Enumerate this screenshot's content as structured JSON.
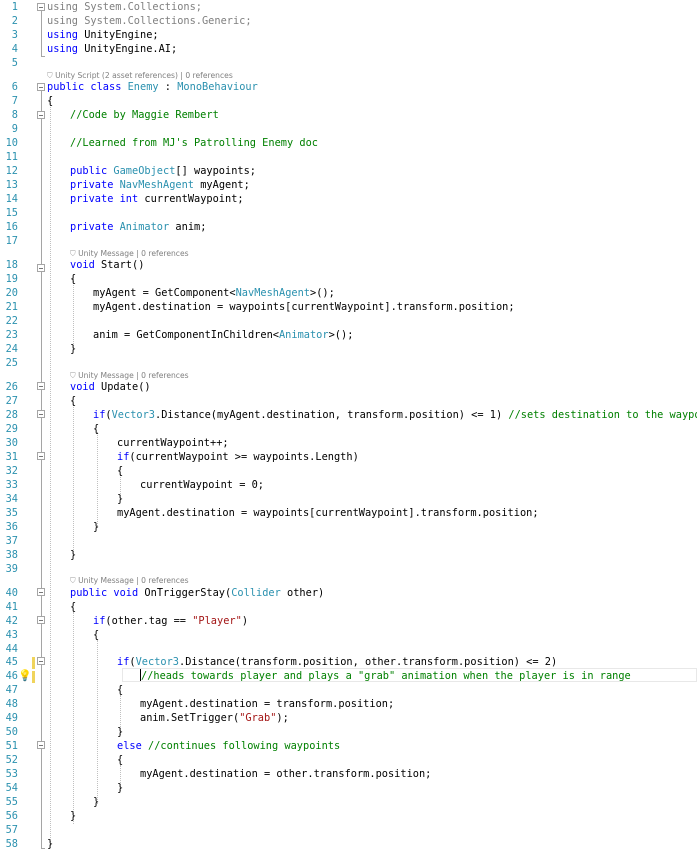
{
  "editor": {
    "codelens": {
      "class": "Unity Script (2 asset references) | 0 references",
      "start": "Unity Message | 0 references",
      "update": "Unity Message | 0 references",
      "trigger": "Unity Message | 0 references"
    },
    "line_numbers": [
      "1",
      "2",
      "3",
      "4",
      "5",
      "6",
      "7",
      "8",
      "9",
      "10",
      "11",
      "12",
      "13",
      "14",
      "15",
      "16",
      "17",
      "18",
      "19",
      "20",
      "21",
      "22",
      "23",
      "24",
      "25",
      "26",
      "27",
      "28",
      "29",
      "30",
      "31",
      "32",
      "33",
      "34",
      "35",
      "36",
      "37",
      "38",
      "39",
      "40",
      "41",
      "42",
      "43",
      "44",
      "45",
      "46",
      "47",
      "48",
      "49",
      "50",
      "51",
      "52",
      "53",
      "54",
      "55",
      "56",
      "57",
      "58"
    ],
    "colors": {
      "keyword": "#0000ff",
      "type": "#2b91af",
      "comment": "#008000",
      "string": "#a31515",
      "line_number": "#2b91af"
    },
    "code": {
      "l1a": "using",
      "l1b": " System.Collections;",
      "l2a": "using",
      "l2b": " System.Collections.Generic;",
      "l3a": "using",
      "l3b": " UnityEngine;",
      "l4a": "using",
      "l4b": " UnityEngine.AI;",
      "l6a": "public",
      "l6b": " ",
      "l6c": "class",
      "l6d": " ",
      "l6e": "Enemy",
      "l6f": " : ",
      "l6g": "MonoBehaviour",
      "l7": "{",
      "l8": "//Code by Maggie Rembert",
      "l10": "//Learned from MJ's Patrolling Enemy doc",
      "l12a": "public",
      "l12b": " ",
      "l12c": "GameObject",
      "l12d": "[] waypoints;",
      "l13a": "private",
      "l13b": " ",
      "l13c": "NavMeshAgent",
      "l13d": " myAgent;",
      "l14a": "private",
      "l14b": " ",
      "l14c": "int",
      "l14d": " currentWaypoint;",
      "l16a": "private",
      "l16b": " ",
      "l16c": "Animator",
      "l16d": " anim;",
      "l18a": "void",
      "l18b": " Start()",
      "l19": "{",
      "l20a": "myAgent = GetComponent<",
      "l20b": "NavMeshAgent",
      "l20c": ">();",
      "l21": "myAgent.destination = waypoints[currentWaypoint].transform.position;",
      "l23a": "anim = GetComponentInChildren<",
      "l23b": "Animator",
      "l23c": ">();",
      "l24": "}",
      "l26a": "void",
      "l26b": " Update()",
      "l27": "{",
      "l28a": "if",
      "l28b": "(",
      "l28c": "Vector3",
      "l28d": ".Distance(myAgent.destination, transform.position) <= 1) ",
      "l28e": "//sets destination to the waypoints",
      "l29": "{",
      "l30": "currentWaypoint++;",
      "l31a": "if",
      "l31b": "(currentWaypoint >= waypoints.Length)",
      "l32": "{",
      "l33": "currentWaypoint = 0;",
      "l34": "}",
      "l35": "myAgent.destination = waypoints[currentWaypoint].transform.position;",
      "l36": "}",
      "l38": "}",
      "l40a": "public",
      "l40b": " ",
      "l40c": "void",
      "l40d": " OnTriggerStay(",
      "l40e": "Collider",
      "l40f": " other)",
      "l41": "{",
      "l42a": "if",
      "l42b": "(other.tag == ",
      "l42c": "\"Player\"",
      "l42d": ")",
      "l43": "{",
      "l45a": "if",
      "l45b": "(",
      "l45c": "Vector3",
      "l45d": ".Distance(transform.position, other.transform.position) <= 2)",
      "l46": "//heads towards player and plays a \"grab\" animation when the player is in range",
      "l47": "{",
      "l48": "myAgent.destination = transform.position;",
      "l49a": "anim.SetTrigger(",
      "l49b": "\"Grab\"",
      "l49c": ");",
      "l50": "}",
      "l51a": "else",
      "l51b": " ",
      "l51c": "//continues following waypoints",
      "l52": "{",
      "l53": "myAgent.destination = other.transform.position;",
      "l54": "}",
      "l55": "}",
      "l56": "}",
      "l58": "}"
    }
  }
}
